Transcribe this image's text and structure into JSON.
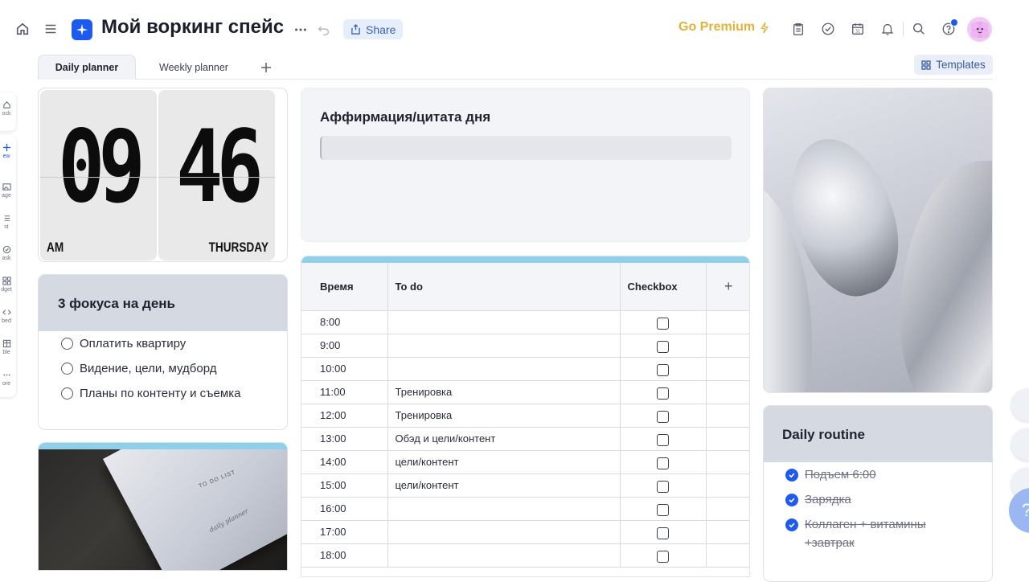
{
  "header": {
    "workspace_title": "Мой воркинг спейс",
    "share_label": "Share",
    "premium_label": "Go Premium"
  },
  "tabs": [
    {
      "label": "Daily planner",
      "active": true
    },
    {
      "label": "Weekly planner",
      "active": false
    }
  ],
  "templates_label": "Templates",
  "left_toolbar": [
    "ock",
    "ew",
    "age",
    "st",
    "ask",
    "dget",
    "bed",
    "ble",
    "ore"
  ],
  "clock": {
    "hours": "09",
    "minutes": "46",
    "period": "AM",
    "day": "THURSDAY"
  },
  "focus": {
    "title": "3 фокуса на день",
    "items": [
      "Оплатить квартиру",
      "Видение, цели, мудборд",
      "Планы по контенту и съемка"
    ]
  },
  "photo_note": {
    "line1": "TO DO LIST",
    "line2": "daily planner"
  },
  "quote": {
    "title": "Аффирмация/цитата дня"
  },
  "schedule": {
    "columns": [
      "Время",
      "To do",
      "Checkbox",
      "+"
    ],
    "rows": [
      {
        "time": "8:00",
        "todo": ""
      },
      {
        "time": "9:00",
        "todo": ""
      },
      {
        "time": "10:00",
        "todo": ""
      },
      {
        "time": "11:00",
        "todo": "Тренировка"
      },
      {
        "time": "12:00",
        "todo": "Тренировка"
      },
      {
        "time": "13:00",
        "todo": "Обэд и цели/контент"
      },
      {
        "time": "14:00",
        "todo": "цели/контент"
      },
      {
        "time": "15:00",
        "todo": "цели/контент"
      },
      {
        "time": "16:00",
        "todo": ""
      },
      {
        "time": "17:00",
        "todo": ""
      },
      {
        "time": "18:00",
        "todo": ""
      }
    ]
  },
  "routine": {
    "title": "Daily routine",
    "items": [
      "Подъем 6:00",
      "Зарядка",
      "Коллаген + витамины +завтрак"
    ]
  },
  "colors": {
    "accent": "#1d5bf0",
    "premium": "#e2b23a",
    "header_gray": "#d4d9e2",
    "table_accent": "#8ed0ea"
  }
}
